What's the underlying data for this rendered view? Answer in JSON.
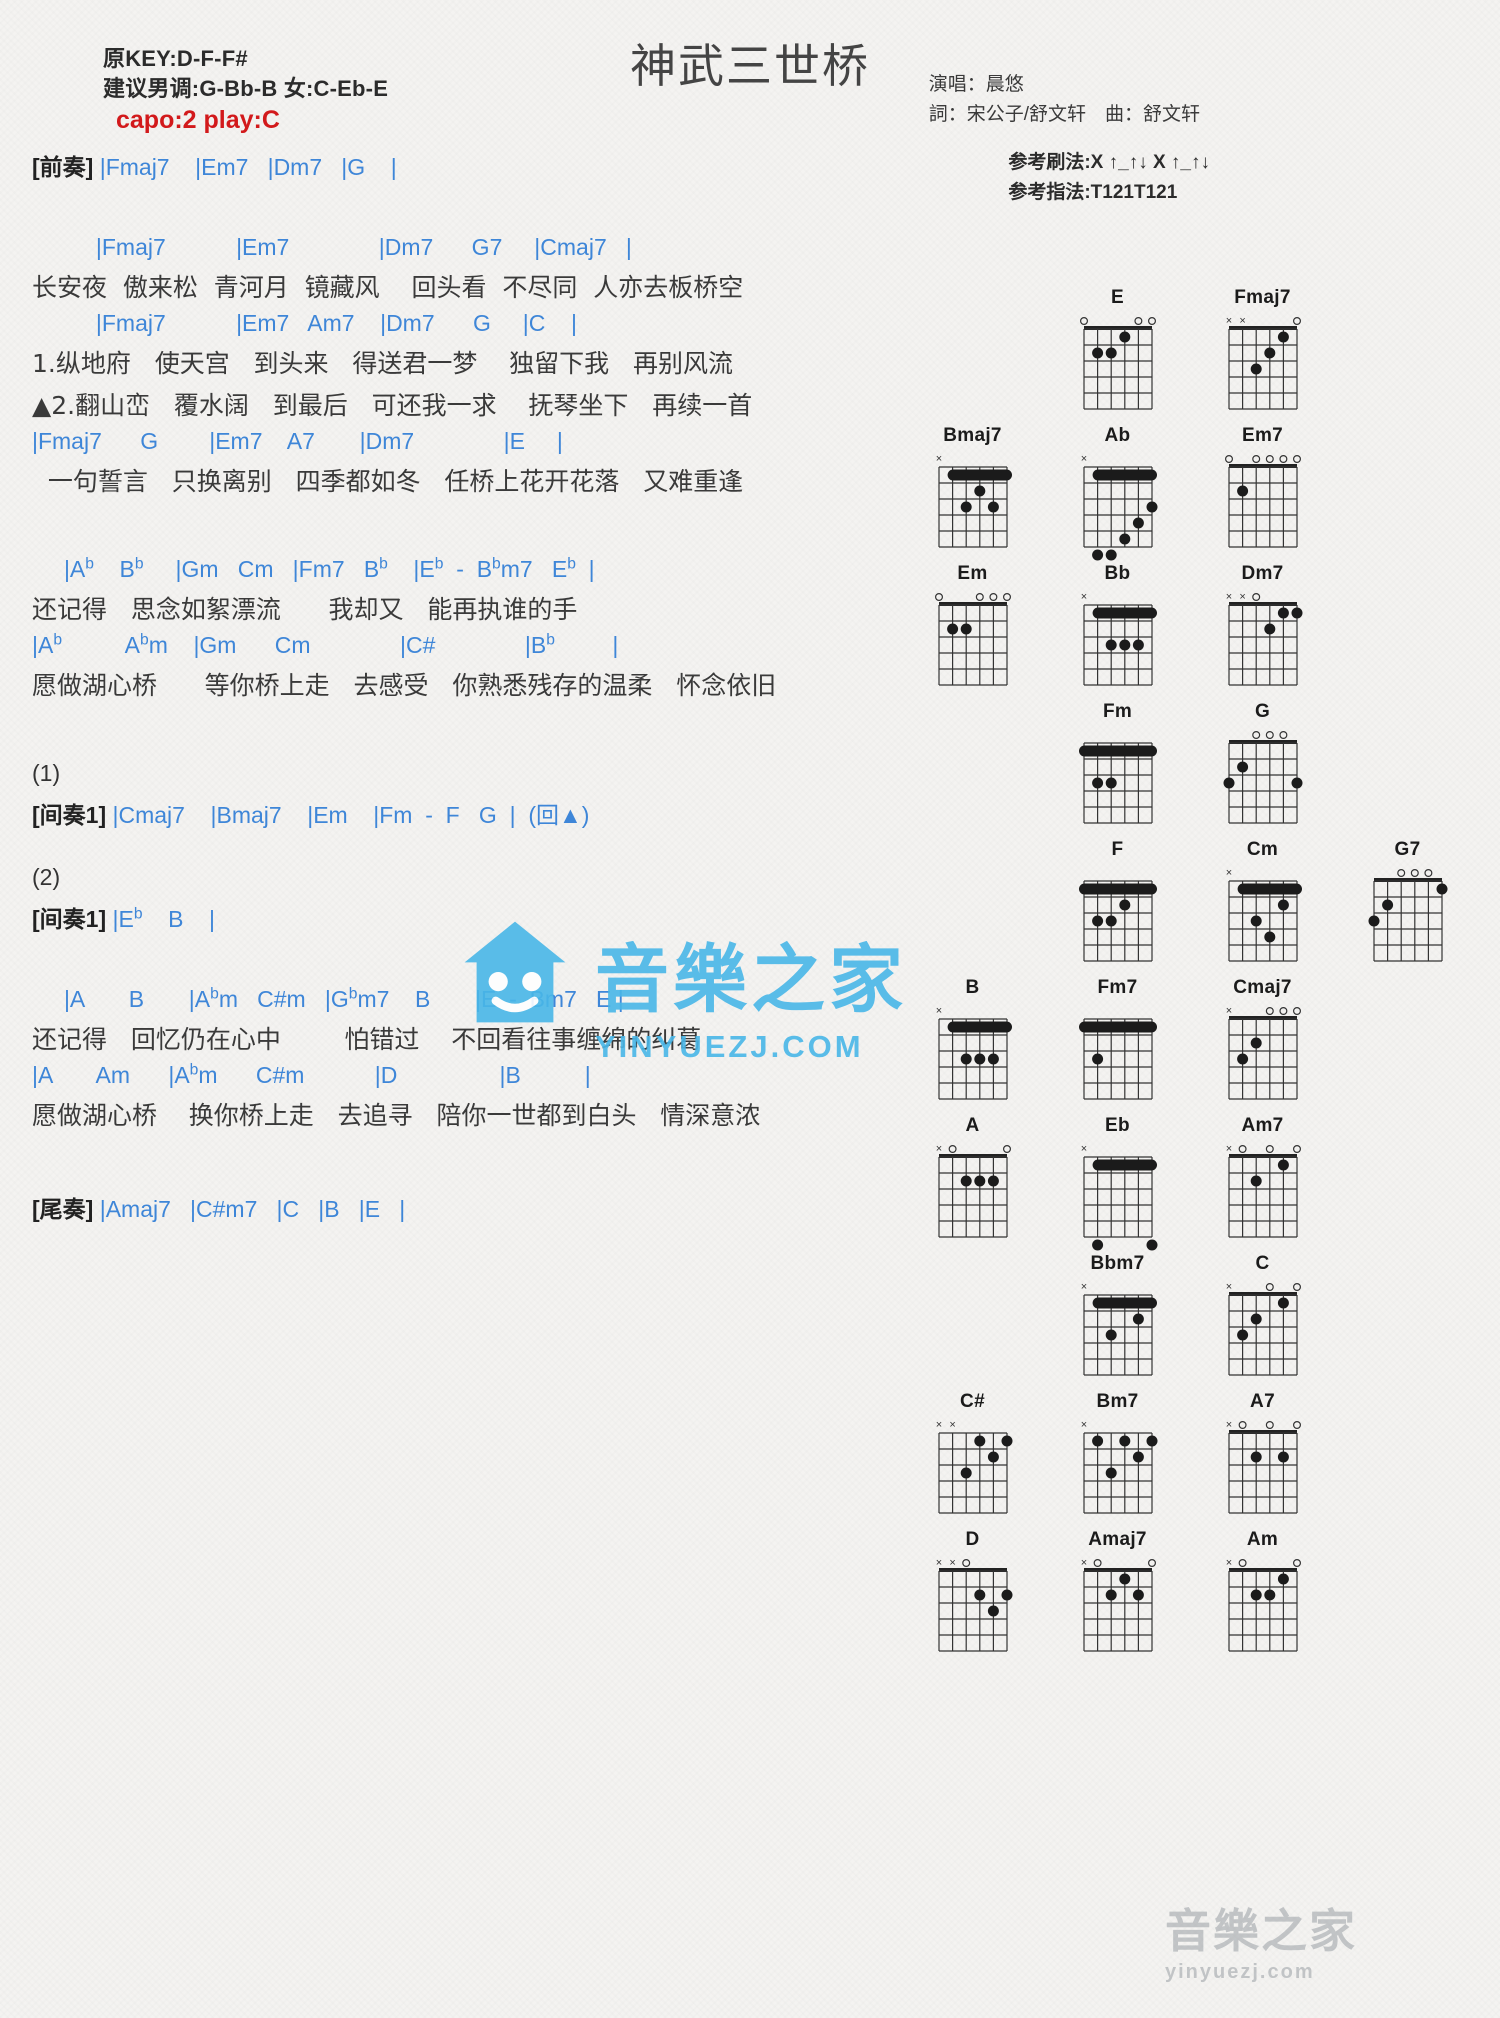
{
  "header": {
    "original_key": "原KEY:D-F-F#",
    "suggested_key": "建议男调:G-Bb-B 女:C-Eb-E",
    "capo": "capo:2 play:C",
    "title": "神武三世桥",
    "singer": "演唱：晨悠",
    "lyricist": "詞：宋公子/舒文轩　曲：舒文轩",
    "strum_pattern": "参考刷法:X ↑_↑↓ X ↑_↑↓",
    "finger_pattern": "参考指法:T121T121",
    "capo_color": "#d2191b",
    "chord_color": "#3e86d8"
  },
  "score": [
    {
      "type": "chord",
      "text": "[前奏] |Fmaj7    |Em7   |Dm7   |G    |"
    },
    {
      "type": "gap",
      "size": "l"
    },
    {
      "type": "chord",
      "text": "          |Fmaj7           |Em7              |Dm7      G7     |Cmaj7   |"
    },
    {
      "type": "lyric",
      "text": "长安夜  傲来松  青河月  镜藏风    回头看  不尽同  人亦去板桥空"
    },
    {
      "type": "chord",
      "text": "          |Fmaj7           |Em7   Am7    |Dm7      G     |C    |"
    },
    {
      "type": "lyric",
      "text": "1.纵地府   使天宫   到头来   得送君一梦    独留下我   再别风流"
    },
    {
      "type": "lyric",
      "text": "▲2.翻山峦   覆水阔   到最后   可还我一求    抚琴坐下   再续一首"
    },
    {
      "type": "chord",
      "text": "|Fmaj7      G        |Em7    A7       |Dm7              |E     |"
    },
    {
      "type": "lyric",
      "text": "  一句誓言   只换离别   四季都如冬   任桥上花开花落   又难重逢"
    },
    {
      "type": "gap",
      "size": "l"
    },
    {
      "type": "chord",
      "text": "     |A♭    B♭     |Gm   Cm   |Fm7   B♭    |E♭  -  B♭m7   E♭  |"
    },
    {
      "type": "lyric",
      "text": "还记得   思念如絮漂流      我却又   能再执谁的手"
    },
    {
      "type": "chord",
      "text": "|A♭          A♭m    |Gm      Cm              |C#              |B♭         |"
    },
    {
      "type": "lyric",
      "text": "愿做湖心桥      等你桥上走   去感受   你熟悉残存的温柔   怀念依旧"
    },
    {
      "type": "gap",
      "size": "l"
    },
    {
      "type": "marker",
      "text": "(1)"
    },
    {
      "type": "chord",
      "text": "[间奏1] |Cmaj7    |Bmaj7    |Em    |Fm  -  F   G  |  (回▲)"
    },
    {
      "type": "gap",
      "size": "m"
    },
    {
      "type": "marker",
      "text": "(2)"
    },
    {
      "type": "chord",
      "text": "[间奏1] |E♭    B    |"
    },
    {
      "type": "gap",
      "size": "l"
    },
    {
      "type": "chord",
      "text": "     |A       B       |A♭m   C#m   |G♭m7    B       |E  -  Bm7   E |"
    },
    {
      "type": "lyric",
      "text": "还记得   回忆仍在心中        怕错过    不回看往事缠绵的纠葛"
    },
    {
      "type": "chord",
      "text": "|A       Am      |A♭m      C#m           |D                |B          |"
    },
    {
      "type": "lyric",
      "text": "愿做湖心桥    换你桥上走   去追寻   陪你一世都到白头   情深意浓"
    },
    {
      "type": "gap",
      "size": "l"
    },
    {
      "type": "chord",
      "text": "[尾奏] |Amaj7   |C#m7   |C   |B   |E   |"
    }
  ],
  "diagram_rows": [
    [
      {
        "name": "",
        "blank": true
      },
      {
        "name": "E",
        "start": 0,
        "markers": "022100",
        "barre": null
      },
      {
        "name": "Fmaj7",
        "start": 0,
        "markers": "xx3210",
        "barre": null
      }
    ],
    [
      {
        "name": "Bmaj7",
        "start": 1,
        "markers": "x13231",
        "barre": {
          "fret": 1,
          "from": 1,
          "to": 5
        }
      },
      {
        "name": "Ab",
        "start": 4,
        "markers": "x66543",
        "barre": {
          "fret": 1,
          "from": 1,
          "to": 5
        }
      },
      {
        "name": "Em7",
        "start": 0,
        "markers": "020000",
        "barre": null
      }
    ],
    [
      {
        "name": "Em",
        "start": 0,
        "markers": "022000",
        "barre": null
      },
      {
        "name": "Bb",
        "start": 1,
        "markers": "x13331",
        "barre": {
          "fret": 1,
          "from": 1,
          "to": 5
        }
      },
      {
        "name": "Dm7",
        "start": 0,
        "markers": "xx0211",
        "barre": null
      }
    ],
    [
      {
        "name": "",
        "blank": true
      },
      {
        "name": "Fm",
        "start": 1,
        "markers": "133111",
        "barre": {
          "fret": 1,
          "from": 0,
          "to": 5
        }
      },
      {
        "name": "G",
        "start": 0,
        "markers": "320003",
        "barre": null
      }
    ],
    [
      {
        "name": "",
        "blank": true
      },
      {
        "name": "F",
        "start": 1,
        "markers": "133211",
        "barre": {
          "fret": 1,
          "from": 0,
          "to": 5
        }
      },
      {
        "name": "Cm",
        "start": 3,
        "markers": "x13421",
        "barre": {
          "fret": 1,
          "from": 1,
          "to": 5
        }
      },
      {
        "name": "G7",
        "start": 0,
        "markers": "320001",
        "barre": null
      }
    ],
    [
      {
        "name": "B",
        "start": 2,
        "markers": "x13331",
        "barre": {
          "fret": 1,
          "from": 1,
          "to": 5
        }
      },
      {
        "name": "Fm7",
        "start": 1,
        "markers": "131111",
        "barre": {
          "fret": 1,
          "from": 0,
          "to": 5
        }
      },
      {
        "name": "Cmaj7",
        "start": 0,
        "markers": "x32000",
        "barre": null
      }
    ],
    [
      {
        "name": "A",
        "start": 0,
        "markers": "x02220",
        "barre": null
      },
      {
        "name": "Eb",
        "start": 6,
        "markers": "x68886",
        "barre": {
          "fret": 1,
          "from": 1,
          "to": 5
        }
      },
      {
        "name": "Am7",
        "start": 0,
        "markers": "x02010",
        "barre": null
      }
    ],
    [
      {
        "name": "",
        "blank": true
      },
      {
        "name": "Bbm7",
        "start": 1,
        "markers": "x13121",
        "barre": {
          "fret": 1,
          "from": 1,
          "to": 5
        }
      },
      {
        "name": "C",
        "start": 0,
        "markers": "x32010",
        "barre": null
      }
    ],
    [
      {
        "name": "C#",
        "start": 4,
        "markers": "xx3121",
        "barre": null
      },
      {
        "name": "Bm7",
        "start": 2,
        "markers": "x13121",
        "barre": null
      },
      {
        "name": "A7",
        "start": 0,
        "markers": "x02020",
        "barre": null
      }
    ],
    [
      {
        "name": "D",
        "start": 0,
        "markers": "xx0232",
        "barre": null
      },
      {
        "name": "Amaj7",
        "start": 0,
        "markers": "x02120",
        "barre": null
      },
      {
        "name": "Am",
        "start": 0,
        "markers": "x02210",
        "barre": null
      }
    ]
  ],
  "watermark": {
    "main": "音樂之家",
    "sub": "YINYUEZJ.COM",
    "corner_main": "音樂之家",
    "corner_sub": "yinyuezj.com",
    "color": "#49b7e8"
  }
}
